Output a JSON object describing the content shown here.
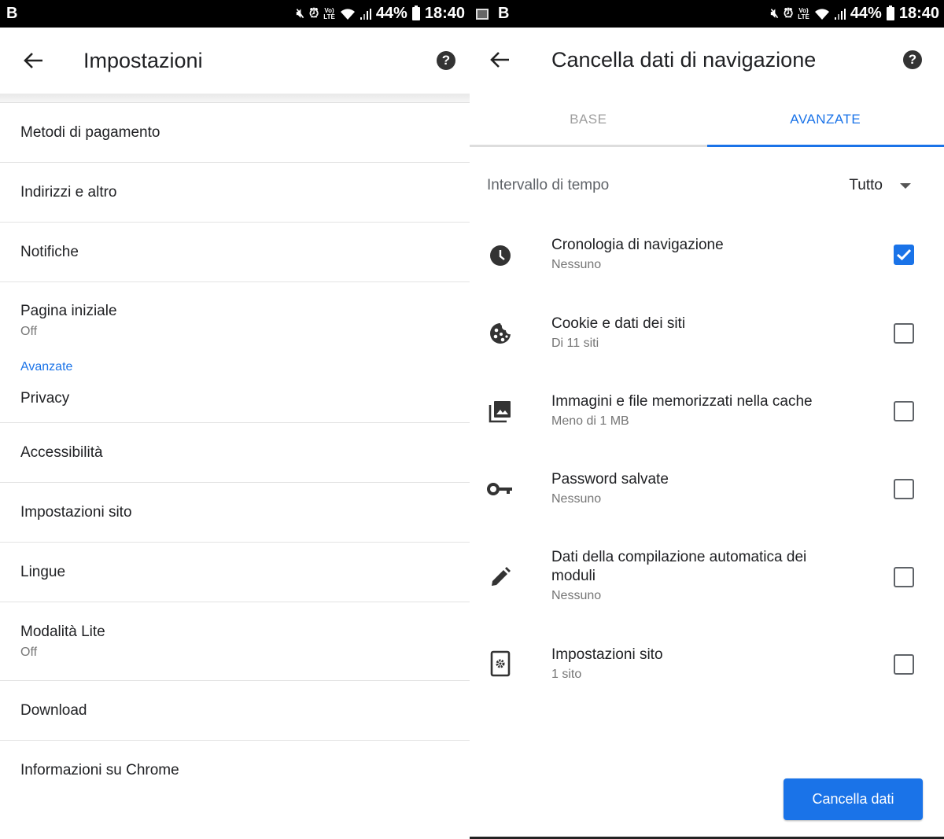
{
  "status_bar": {
    "left_screen": {
      "app_letter": "B",
      "battery": "44%",
      "time": "18:40",
      "volte": "VoLTE"
    },
    "right_screen": {
      "app_letter": "B",
      "battery": "44%",
      "time": "18:40",
      "volte": "VoLTE"
    }
  },
  "settings_screen": {
    "title": "Impostazioni",
    "items": [
      {
        "label": "Metodi di pagamento"
      },
      {
        "label": "Indirizzi e altro"
      },
      {
        "label": "Notifiche"
      },
      {
        "label": "Pagina iniziale",
        "sub": "Off"
      }
    ],
    "section_header": "Avanzate",
    "advanced_items": [
      {
        "label": "Privacy"
      },
      {
        "label": "Accessibilità"
      },
      {
        "label": "Impostazioni sito"
      },
      {
        "label": "Lingue"
      },
      {
        "label": "Modalità Lite",
        "sub": "Off"
      },
      {
        "label": "Download"
      },
      {
        "label": "Informazioni su Chrome"
      }
    ]
  },
  "clear_data_screen": {
    "title": "Cancella dati di navigazione",
    "tabs": [
      {
        "label": "BASE",
        "active": false
      },
      {
        "label": "AVANZATE",
        "active": true
      }
    ],
    "time_range": {
      "label": "Intervallo di tempo",
      "value": "Tutto"
    },
    "items": [
      {
        "icon": "clock-icon",
        "label": "Cronologia di navigazione",
        "sub": "Nessuno",
        "checked": true
      },
      {
        "icon": "cookie-icon",
        "label": "Cookie e dati dei siti",
        "sub": "Di 11 siti",
        "checked": false
      },
      {
        "icon": "image-icon",
        "label": "Immagini e file memorizzati nella cache",
        "sub": "Meno di 1 MB",
        "checked": false
      },
      {
        "icon": "key-icon",
        "label": "Password salvate",
        "sub": "Nessuno",
        "checked": false
      },
      {
        "icon": "pencil-icon",
        "label": "Dati della compilazione automatica dei moduli",
        "sub": "Nessuno",
        "checked": false
      },
      {
        "icon": "site-settings-icon",
        "label": "Impostazioni sito",
        "sub": "1 sito",
        "checked": false
      }
    ],
    "clear_button": "Cancella dati"
  },
  "colors": {
    "accent": "#1a73e8",
    "text_primary": "#202124",
    "text_secondary": "#757575"
  }
}
